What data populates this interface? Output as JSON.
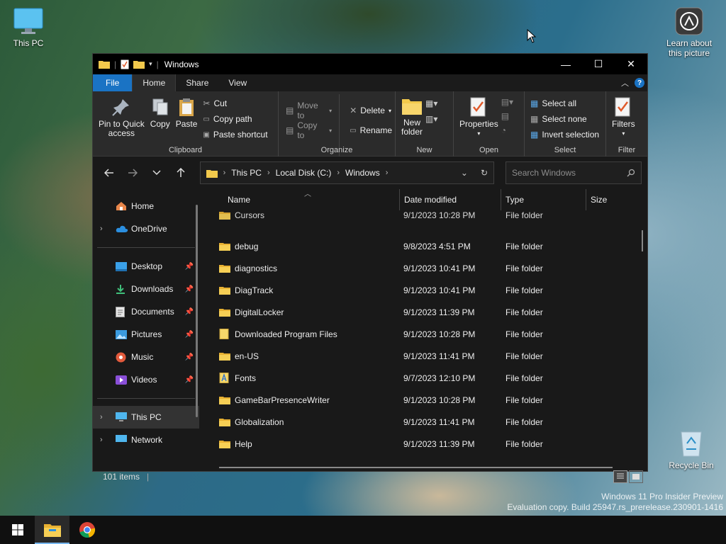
{
  "desktop": {
    "icons": {
      "this_pc": "This PC",
      "learn": "Learn about this picture",
      "recycle_bin": "Recycle Bin"
    },
    "watermark": {
      "line1": "Windows 11 Pro Insider Preview",
      "line2": "Evaluation copy. Build 25947.rs_prerelease.230901-1416"
    }
  },
  "window": {
    "title": "Windows",
    "controls": {
      "minimize": "—",
      "maximize": "☐",
      "close": "✕"
    }
  },
  "ribbon_tabs": {
    "file": "File",
    "home": "Home",
    "share": "Share",
    "view": "View"
  },
  "ribbon": {
    "clipboard": {
      "label": "Clipboard",
      "pin_line1": "Pin to Quick",
      "pin_line2": "access",
      "copy": "Copy",
      "paste": "Paste",
      "cut": "Cut",
      "copy_path": "Copy path",
      "paste_shortcut": "Paste shortcut"
    },
    "organize": {
      "label": "Organize",
      "move_to": "Move to",
      "copy_to": "Copy to",
      "delete": "Delete",
      "rename": "Rename"
    },
    "new": {
      "label": "New",
      "new_line1": "New",
      "new_line2": "folder"
    },
    "open": {
      "label": "Open",
      "properties": "Properties"
    },
    "select": {
      "label": "Select",
      "select_all": "Select all",
      "select_none": "Select none",
      "invert_selection": "Invert selection"
    },
    "filter": {
      "label": "Filter",
      "filters": "Filters"
    }
  },
  "address": {
    "crumbs": [
      "This PC",
      "Local Disk (C:)",
      "Windows"
    ],
    "search_placeholder": "Search Windows"
  },
  "nav": {
    "home": "Home",
    "onedrive": "OneDrive",
    "desktop": "Desktop",
    "downloads": "Downloads",
    "documents": "Documents",
    "pictures": "Pictures",
    "music": "Music",
    "videos": "Videos",
    "this_pc": "This PC",
    "network": "Network"
  },
  "columns": {
    "name": "Name",
    "date": "Date modified",
    "type": "Type",
    "size": "Size"
  },
  "files": [
    {
      "name": "Cursors",
      "date": "9/1/2023 10:28 PM",
      "type": "File folder"
    },
    {
      "name": "debug",
      "date": "9/8/2023 4:51 PM",
      "type": "File folder"
    },
    {
      "name": "diagnostics",
      "date": "9/1/2023 10:41 PM",
      "type": "File folder"
    },
    {
      "name": "DiagTrack",
      "date": "9/1/2023 10:41 PM",
      "type": "File folder"
    },
    {
      "name": "DigitalLocker",
      "date": "9/1/2023 11:39 PM",
      "type": "File folder"
    },
    {
      "name": "Downloaded Program Files",
      "date": "9/1/2023 10:28 PM",
      "type": "File folder"
    },
    {
      "name": "en-US",
      "date": "9/1/2023 11:41 PM",
      "type": "File folder"
    },
    {
      "name": "Fonts",
      "date": "9/7/2023 12:10 PM",
      "type": "File folder"
    },
    {
      "name": "GameBarPresenceWriter",
      "date": "9/1/2023 10:28 PM",
      "type": "File folder"
    },
    {
      "name": "Globalization",
      "date": "9/1/2023 11:41 PM",
      "type": "File folder"
    },
    {
      "name": "Help",
      "date": "9/1/2023 11:39 PM",
      "type": "File folder"
    }
  ],
  "status": {
    "count": "101 items"
  },
  "colors": {
    "accent": "#1a73c4",
    "folder": "#f2c94c",
    "window_bg": "#191919",
    "ribbon_bg": "#2b2b2b"
  }
}
